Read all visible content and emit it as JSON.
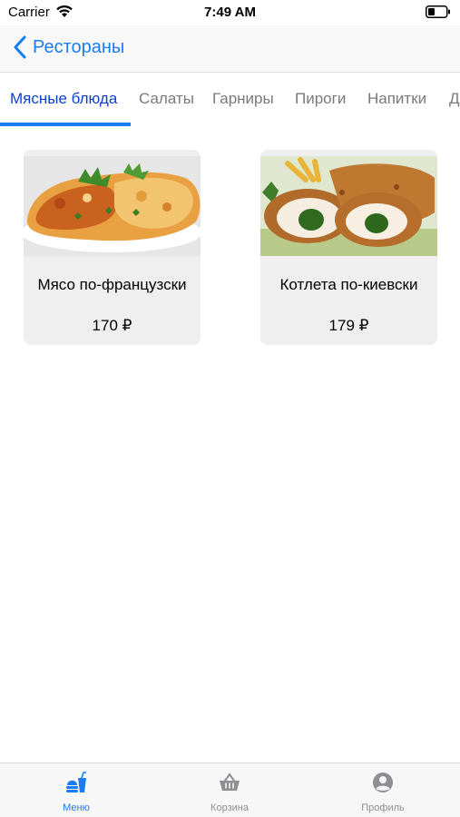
{
  "status_bar": {
    "carrier": "Carrier",
    "time": "7:49 AM"
  },
  "nav": {
    "back_label": "Рестораны"
  },
  "categories": [
    {
      "label": "Мясные блюда",
      "active": true
    },
    {
      "label": "Салаты"
    },
    {
      "label": "Гарниры"
    },
    {
      "label": "Пироги"
    },
    {
      "label": "Напитки"
    },
    {
      "label": "Д"
    }
  ],
  "products": [
    {
      "name": "Мясо по-французски",
      "price": "170 ₽",
      "image": "baked-meat-with-cheese-photo"
    },
    {
      "name": "Котлета по-киевски",
      "price": "179 ₽",
      "image": "chicken-kiev-cutlet-photo"
    }
  ],
  "tab_bar": {
    "items": [
      {
        "label": "Меню",
        "icon": "menu-food-icon",
        "active": true
      },
      {
        "label": "Корзина",
        "icon": "basket-icon"
      },
      {
        "label": "Профиль",
        "icon": "profile-icon"
      }
    ]
  },
  "colors": {
    "accent": "#1a7cf0",
    "active_tab_text": "#0a3fd0",
    "inactive": "#8e8e93"
  }
}
